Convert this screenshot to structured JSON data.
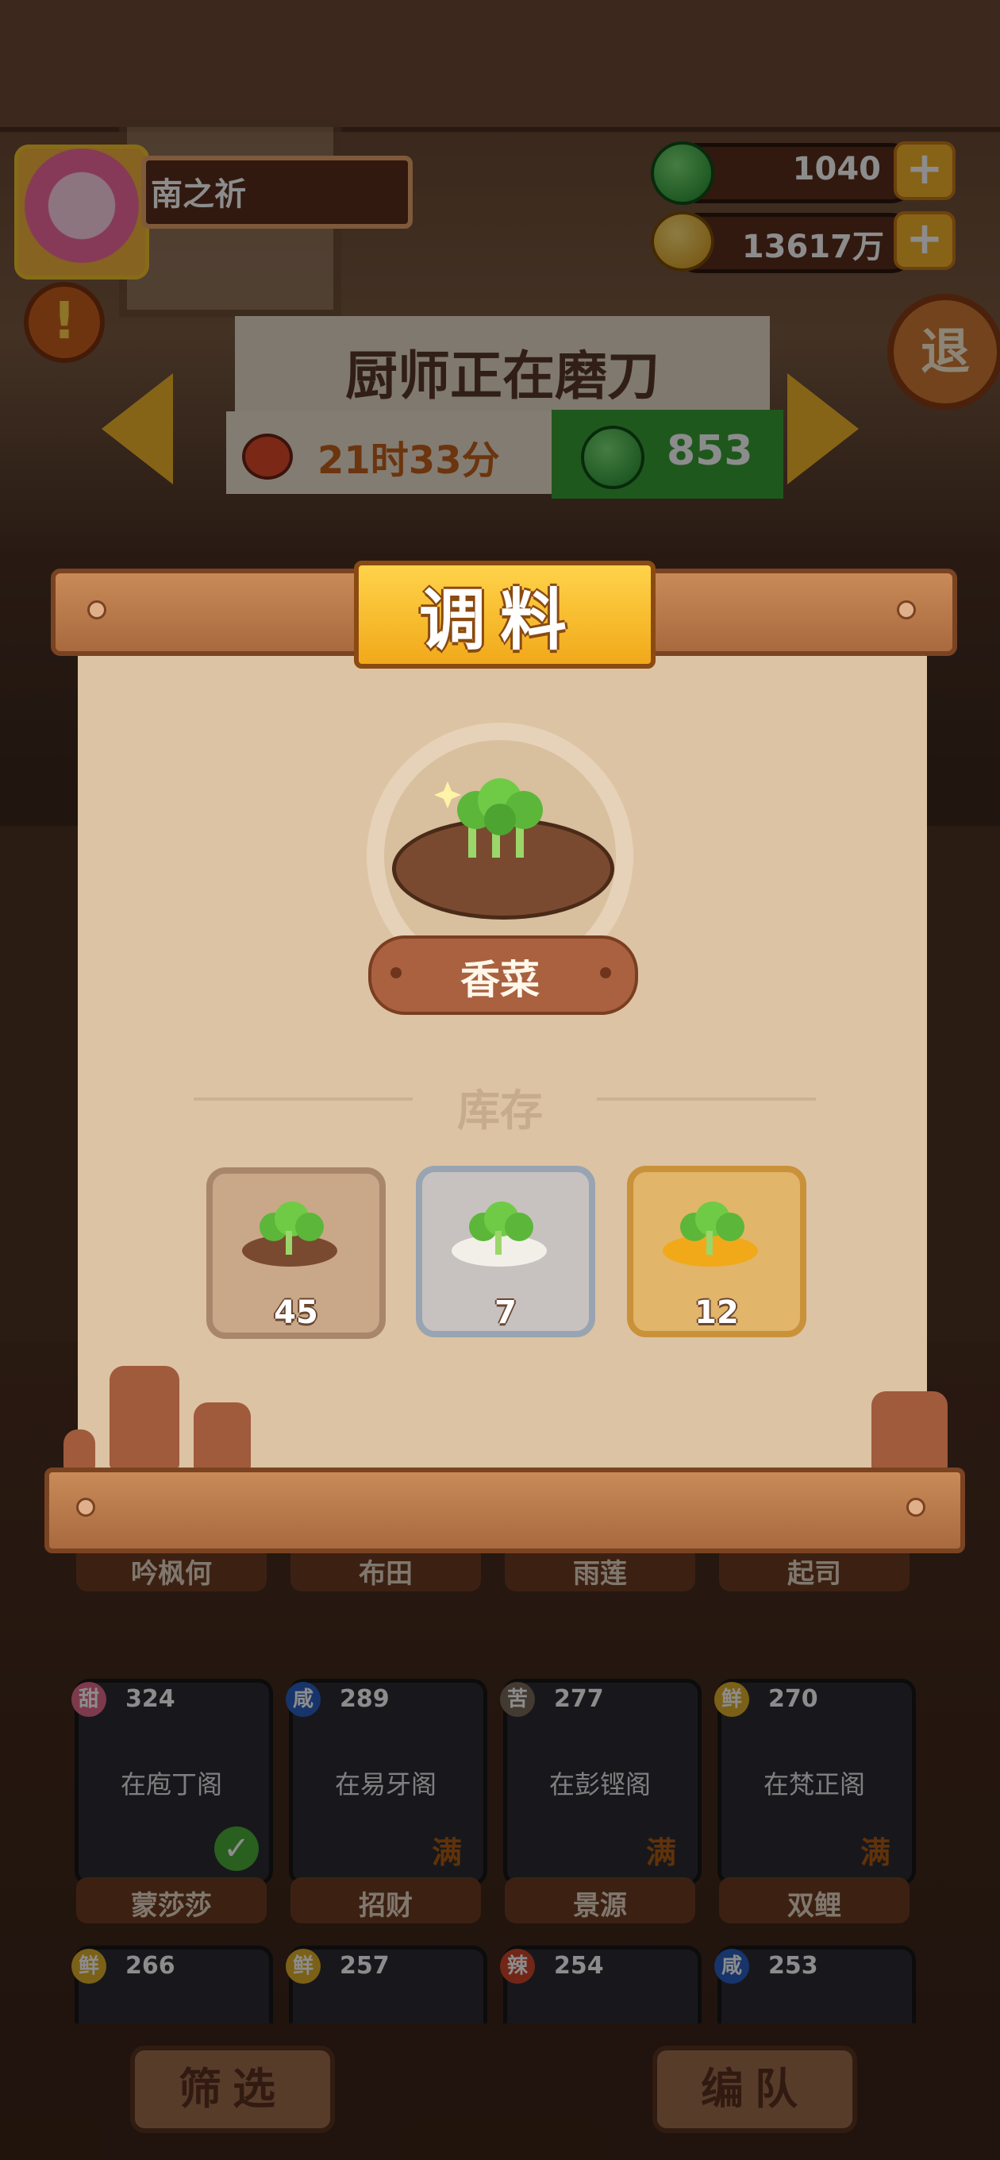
{
  "header": {
    "player_name": "南之祈",
    "gems": "1040",
    "coins": "13617万",
    "plus_label": "+",
    "alert_label": "!",
    "exit_label": "退"
  },
  "status": {
    "title": "厨师正在磨刀",
    "timer": "21时33分",
    "cost": "853"
  },
  "dialog": {
    "title": "调料",
    "item_name": "香菜",
    "stock_label": "库存",
    "stock": [
      {
        "count": "45",
        "tier": "brown"
      },
      {
        "count": "7",
        "tier": "silver"
      },
      {
        "count": "12",
        "tier": "gold"
      }
    ]
  },
  "characters": {
    "row1": [
      "吟枫何",
      "布田",
      "雨莲",
      "起司"
    ],
    "row2": [
      {
        "taste": "甜",
        "score": "324",
        "location": "在庖丁阁",
        "name": "蒙莎莎"
      },
      {
        "taste": "咸",
        "score": "289",
        "location": "在易牙阁",
        "name": "招财"
      },
      {
        "taste": "苦",
        "score": "277",
        "location": "在彭铿阁",
        "name": "景源"
      },
      {
        "taste": "鲜",
        "score": "270",
        "location": "在梵正阁",
        "name": "双鲤"
      }
    ],
    "row3": [
      {
        "taste": "鲜",
        "score": "266"
      },
      {
        "taste": "鲜",
        "score": "257"
      },
      {
        "taste": "辣",
        "score": "254"
      },
      {
        "taste": "咸",
        "score": "253"
      }
    ],
    "full_label": "满"
  },
  "bottom": {
    "filter_label": "筛选",
    "team_label": "编队"
  },
  "colors": {
    "gold": "#f4b62a",
    "green": "#3aa136",
    "panel": "#dcc3a3"
  }
}
